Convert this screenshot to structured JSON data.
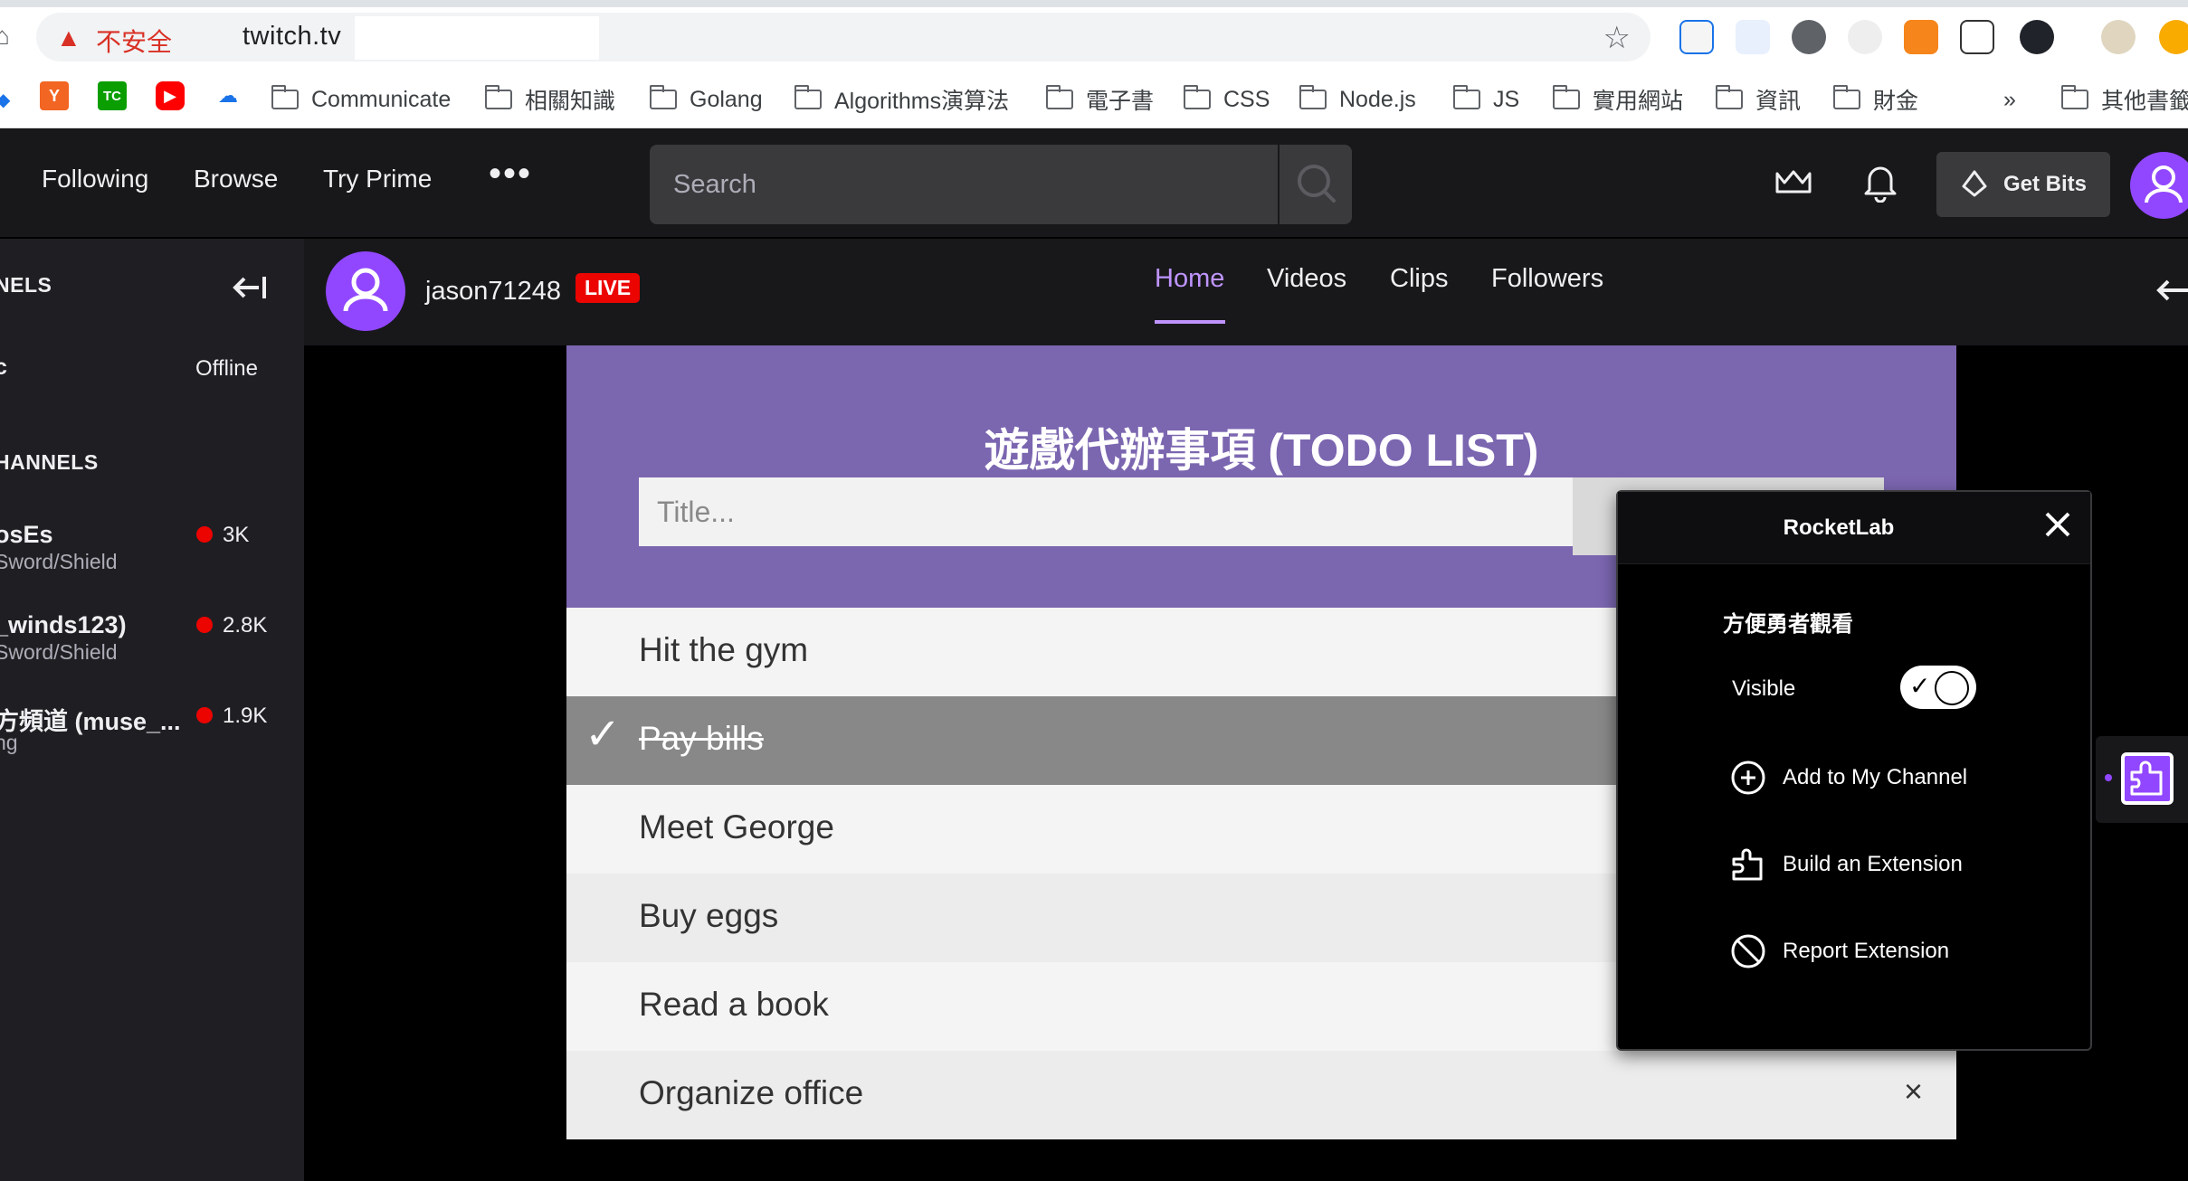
{
  "browser": {
    "insecure_label": "不安全",
    "url": "twitch.tv"
  },
  "bookmarks": [
    {
      "label": "Communicate"
    },
    {
      "label": "相關知識"
    },
    {
      "label": "Golang"
    },
    {
      "label": "Algorithms演算法"
    },
    {
      "label": "電子書"
    },
    {
      "label": "CSS"
    },
    {
      "label": "Node.js"
    },
    {
      "label": "JS"
    },
    {
      "label": "實用網站"
    },
    {
      "label": "資訊"
    },
    {
      "label": "財金"
    },
    {
      "label": "其他書籤"
    }
  ],
  "bookmarks_overflow": "»",
  "bookmark_favicons": {
    "y": "Y",
    "tc": "TC"
  },
  "twitch_nav": {
    "following": "Following",
    "browse": "Browse",
    "try_prime": "Try Prime",
    "more": "•••",
    "search_placeholder": "Search",
    "get_bits": "Get Bits"
  },
  "sidebar": {
    "followed_header": "NELS",
    "followed": {
      "name": "c",
      "status": "Offline"
    },
    "recommended_header": "HANNELS",
    "channels": [
      {
        "name": "osEs",
        "game": "Sword/Shield",
        "viewers": "3K"
      },
      {
        "name": "_winds123)",
        "game": "Sword/Shield",
        "viewers": "2.8K"
      },
      {
        "name": "方頻道 (muse_...",
        "game": "ng",
        "viewers": "1.9K"
      }
    ]
  },
  "channel": {
    "name": "jason71248",
    "live_badge": "LIVE",
    "tabs": [
      "Home",
      "Videos",
      "Clips",
      "Followers"
    ],
    "active_tab": "Home"
  },
  "todo": {
    "title": "遊戲代辦事項 (TODO LIST)",
    "input_placeholder": "Title...",
    "items": [
      {
        "text": "Hit the gym",
        "done": false
      },
      {
        "text": "Pay bills",
        "done": true
      },
      {
        "text": "Meet George",
        "done": false
      },
      {
        "text": "Buy eggs",
        "done": false
      },
      {
        "text": "Read a book",
        "done": false
      },
      {
        "text": "Organize office",
        "done": false
      }
    ],
    "delete_symbol": "×",
    "check_symbol": "✓"
  },
  "popup": {
    "title": "RocketLab",
    "section": "方便勇者觀看",
    "visible_label": "Visible",
    "visible_on": true,
    "actions": [
      {
        "label": "Add to My Channel",
        "icon": "plus-circle-icon"
      },
      {
        "label": "Build an Extension",
        "icon": "puzzle-icon"
      },
      {
        "label": "Report Extension",
        "icon": "ban-icon"
      }
    ]
  },
  "colors": {
    "twitch_purple": "#9147ff",
    "todo_header": "#7b66b0",
    "live_red": "#eb0400",
    "active_tab": "#bf94ff"
  }
}
